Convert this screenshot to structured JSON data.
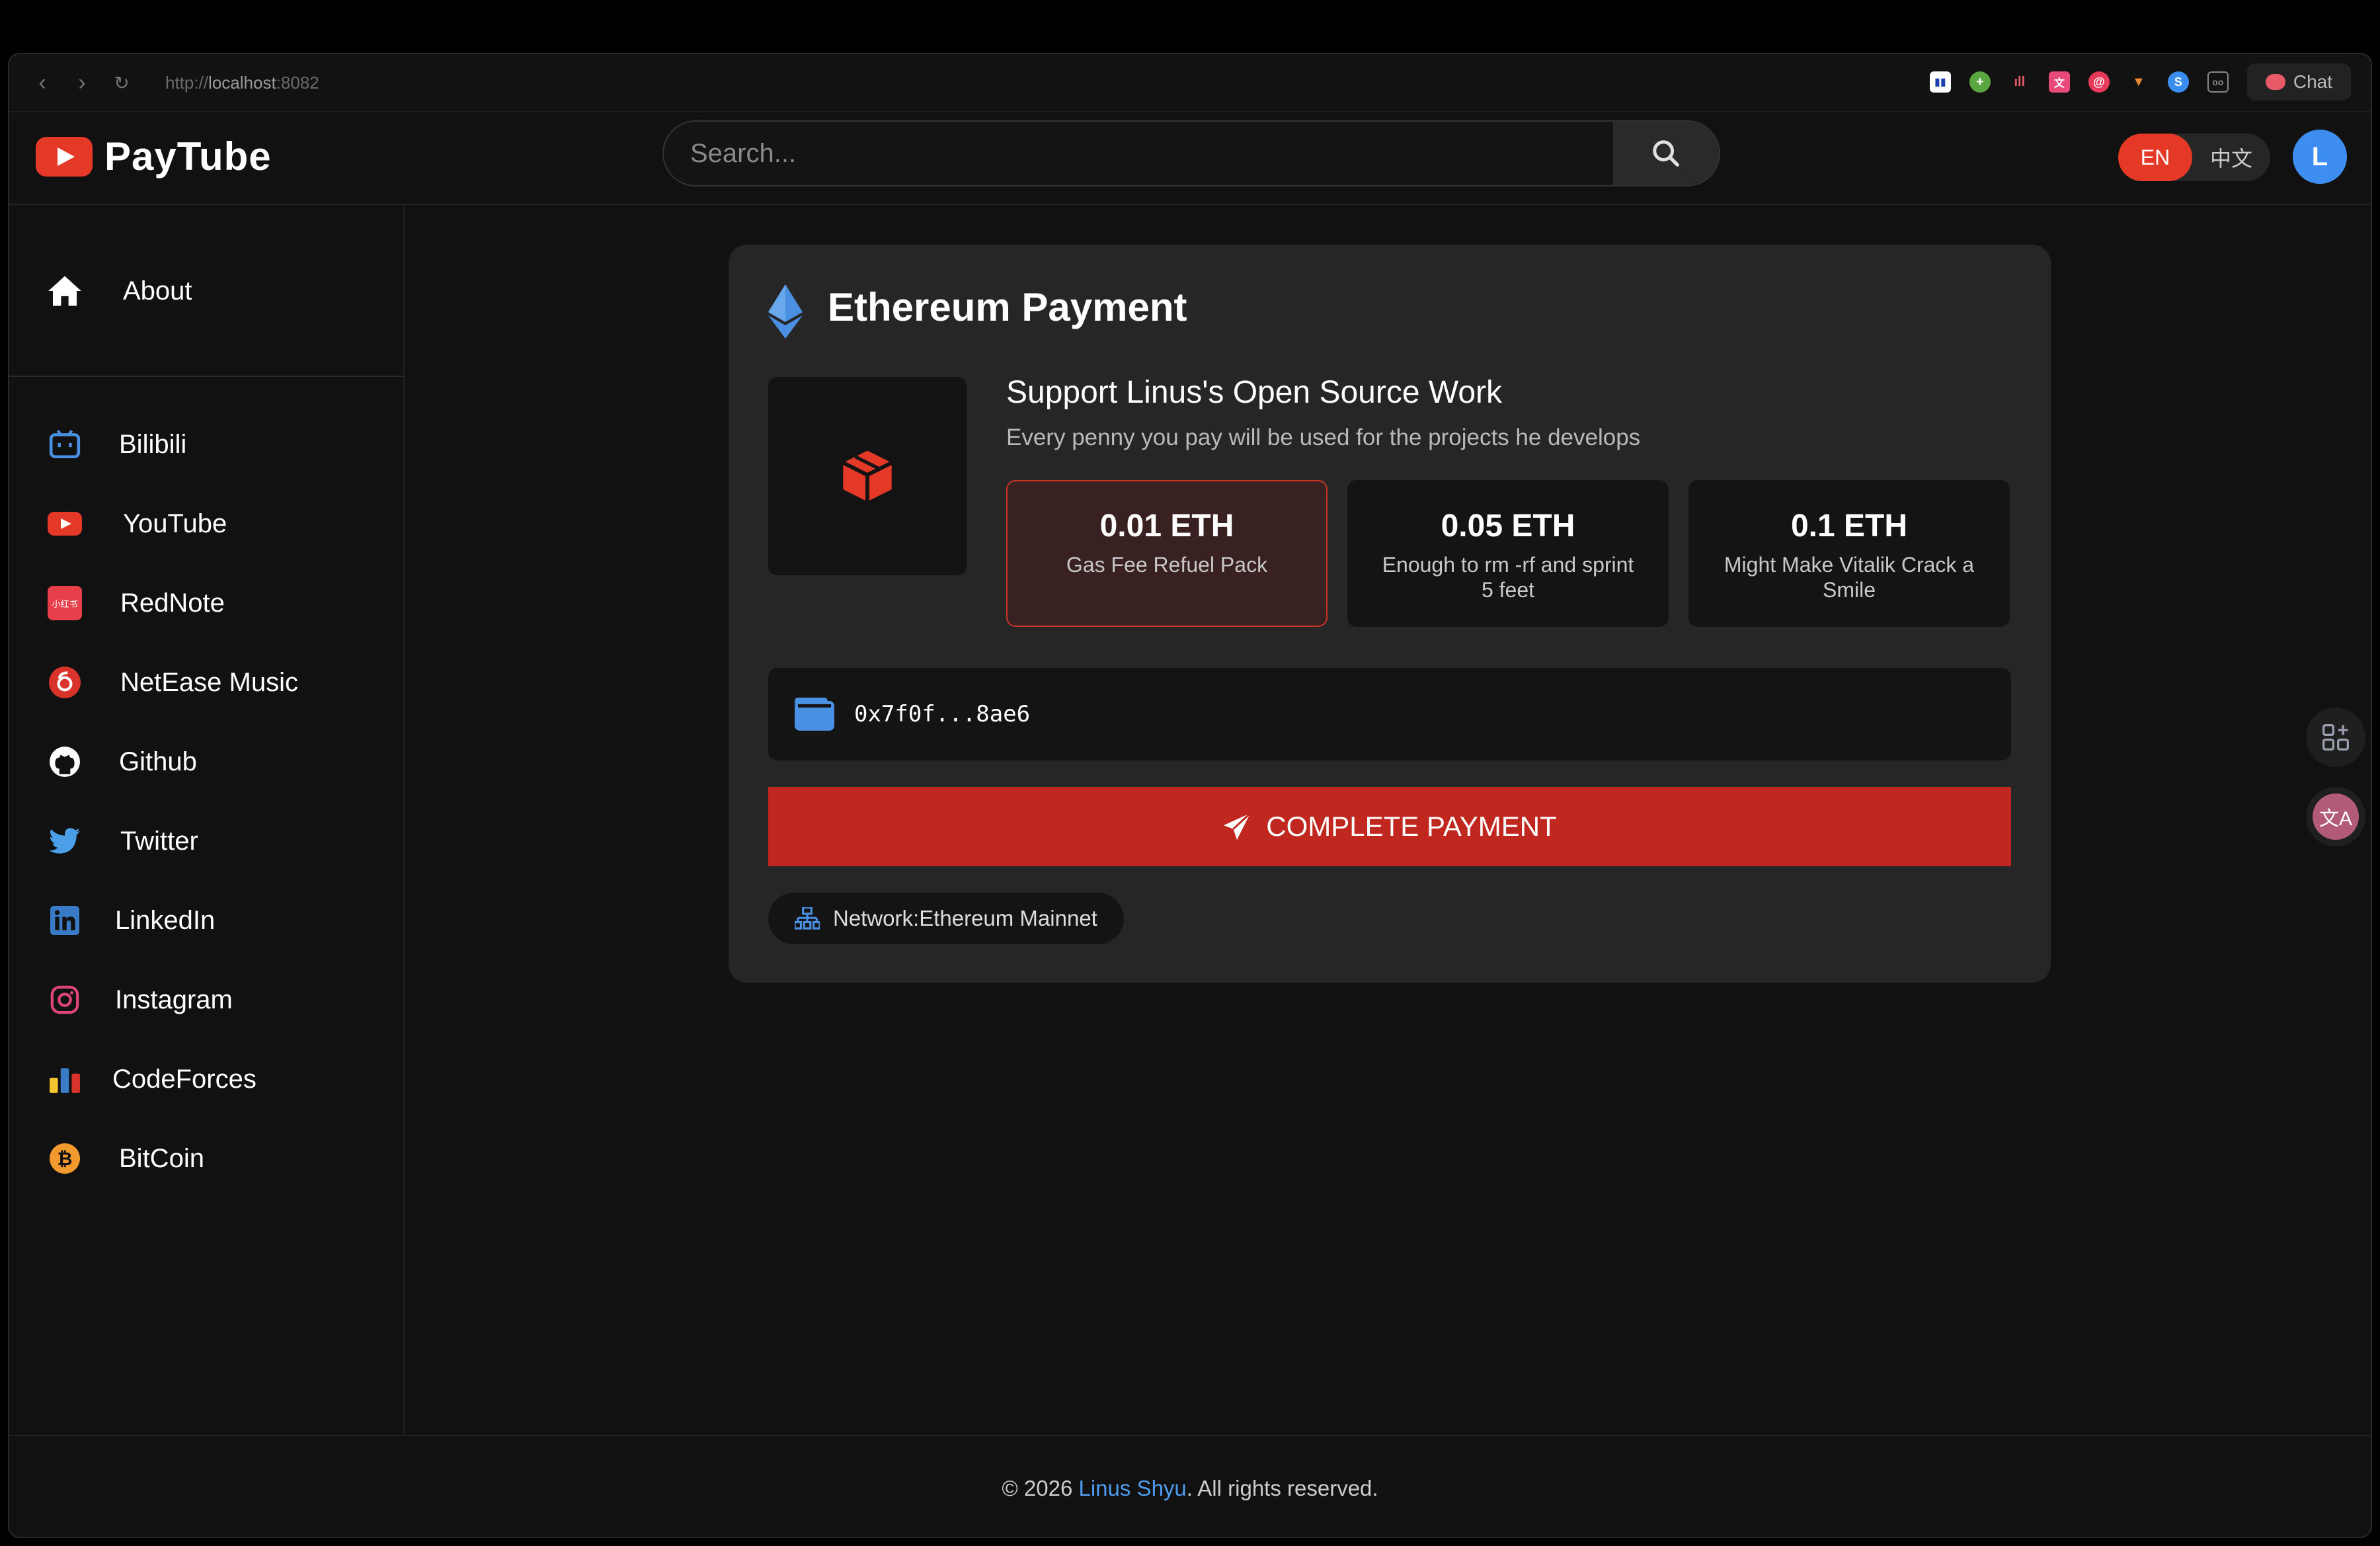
{
  "browser": {
    "url_prefix": "http://",
    "url_host": "localhost",
    "url_port": ":8082",
    "chat_label": "Chat"
  },
  "header": {
    "logo_text": "PayTube",
    "search_placeholder": "Search...",
    "lang_en": "EN",
    "lang_zh": "中文",
    "avatar_initial": "L"
  },
  "sidebar": {
    "items": [
      {
        "label": "About",
        "icon": "home-icon"
      },
      {
        "label": "Bilibili",
        "icon": "bilibili-icon"
      },
      {
        "label": "YouTube",
        "icon": "youtube-icon"
      },
      {
        "label": "RedNote",
        "icon": "rednote-icon"
      },
      {
        "label": "NetEase Music",
        "icon": "netease-icon"
      },
      {
        "label": "Github",
        "icon": "github-icon"
      },
      {
        "label": "Twitter",
        "icon": "twitter-icon"
      },
      {
        "label": "LinkedIn",
        "icon": "linkedin-icon"
      },
      {
        "label": "Instagram",
        "icon": "instagram-icon"
      },
      {
        "label": "CodeForces",
        "icon": "codeforces-icon"
      },
      {
        "label": "BitCoin",
        "icon": "bitcoin-icon"
      }
    ],
    "rednote_glyph": "小红书"
  },
  "payment": {
    "title": "Ethereum Payment",
    "support_title": "Support Linus's Open Source Work",
    "support_subtitle": "Every penny you pay will be used for the projects he develops",
    "options": [
      {
        "amount": "0.01 ETH",
        "desc": "Gas Fee Refuel Pack",
        "selected": true
      },
      {
        "amount": "0.05 ETH",
        "desc": "Enough to rm -rf and sprint 5 feet",
        "selected": false
      },
      {
        "amount": "0.1 ETH",
        "desc": "Might Make Vitalik Crack a Smile",
        "selected": false
      }
    ],
    "wallet_address": "0x7f0f...8ae6",
    "pay_button": "COMPLETE PAYMENT",
    "network": "Network:Ethereum Mainnet"
  },
  "footer": {
    "copyright_prefix": "© 2026 ",
    "author": "Linus Shyu",
    "copyright_suffix": ". All rights reserved."
  },
  "colors": {
    "accent_red": "#e53927",
    "button_red": "#c0271f",
    "link_blue": "#4d9cf0",
    "eth_blue": "#4a90e2"
  }
}
